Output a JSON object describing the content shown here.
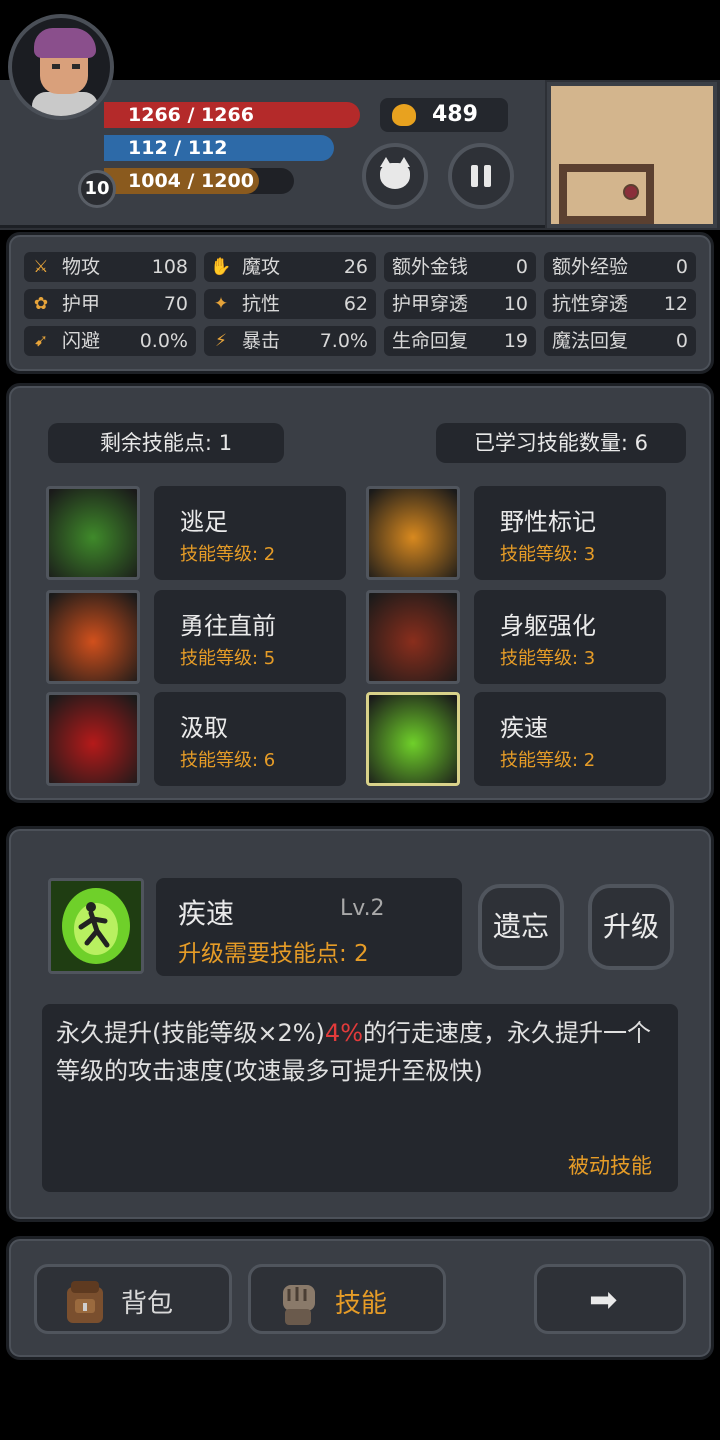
{
  "hud": {
    "hp": "1266 / 1266",
    "mp": "112 / 112",
    "xp": "1004 / 1200",
    "xp_fill": 0.84,
    "level": "10",
    "gold": "489"
  },
  "stats": [
    {
      "icon": "sword-icon",
      "label": "物攻",
      "value": "108"
    },
    {
      "icon": "magic-hand-icon",
      "label": "魔攻",
      "value": "26"
    },
    {
      "icon": "",
      "label": "额外金钱",
      "value": "0"
    },
    {
      "icon": "",
      "label": "额外经验",
      "value": "0"
    },
    {
      "icon": "paw-icon",
      "label": "护甲",
      "value": "70"
    },
    {
      "icon": "muscle-icon",
      "label": "抗性",
      "value": "62"
    },
    {
      "icon": "",
      "label": "护甲穿透",
      "value": "10"
    },
    {
      "icon": "",
      "label": "抗性穿透",
      "value": "12"
    },
    {
      "icon": "running-icon",
      "label": "闪避",
      "value": "0.0%"
    },
    {
      "icon": "lightning-icon",
      "label": "暴击",
      "value": "7.0%"
    },
    {
      "icon": "",
      "label": "生命回复",
      "value": "19"
    },
    {
      "icon": "",
      "label": "魔法回复",
      "value": "0"
    }
  ],
  "skills_panel": {
    "points_remaining": "剩余技能点: 1",
    "learned_count": "已学习技能数量: 6",
    "skills": [
      {
        "name": "逃足",
        "level": "技能等级: 2",
        "icon": "vine-foot-icon",
        "color": "#3f8a2a"
      },
      {
        "name": "野性标记",
        "level": "技能等级: 3",
        "icon": "paw-print-icon",
        "color": "#d8891f"
      },
      {
        "name": "勇往直前",
        "level": "技能等级: 5",
        "icon": "flame-claw-icon",
        "color": "#d1501c"
      },
      {
        "name": "身躯强化",
        "level": "技能等级: 3",
        "icon": "demon-body-icon",
        "color": "#8a2e1c"
      },
      {
        "name": "汲取",
        "level": "技能等级: 6",
        "icon": "blood-drop-icon",
        "color": "#b51a1a"
      },
      {
        "name": "疾速",
        "level": "技能等级: 2",
        "icon": "sprint-icon",
        "color": "#6fd02a"
      }
    ]
  },
  "detail": {
    "name": "疾速",
    "level": "Lv.2",
    "cost": "升级需要技能点: 2",
    "forget_label": "遗忘",
    "upgrade_label": "升级",
    "desc_before": "永久提升(技能等级×2%)",
    "desc_highlight": "4%",
    "desc_after": "的行走速度，永久提升一个等级的攻击速度(攻速最多可提升至极快)",
    "type": "被动技能"
  },
  "bottom": {
    "bag_label": "背包",
    "skill_label": "技能",
    "next_arrow": "➡"
  }
}
